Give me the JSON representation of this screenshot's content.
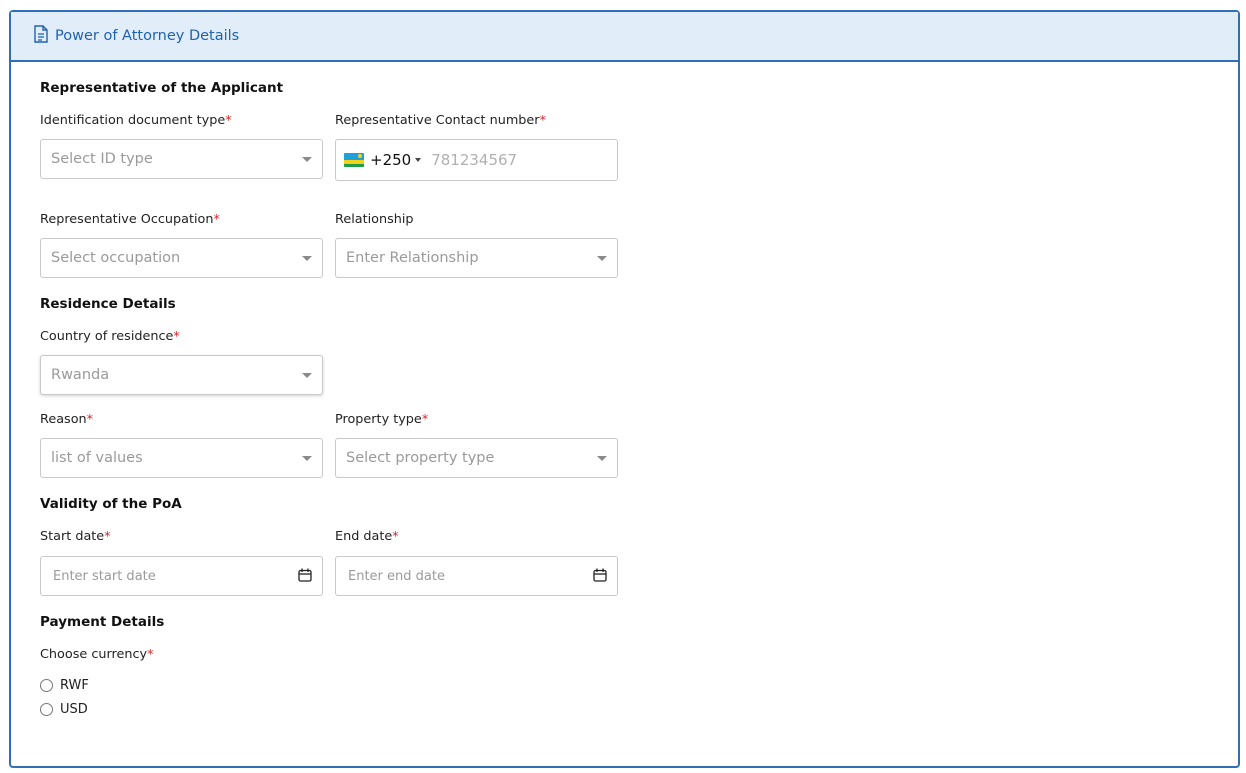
{
  "header": {
    "title": "Power of Attorney Details",
    "icon": "document-icon"
  },
  "sections": {
    "representative": "Representative of the Applicant",
    "residence": "Residence Details",
    "validity": "Validity of the PoA",
    "payment": "Payment Details"
  },
  "fields": {
    "id_type": {
      "label": "Identification document type",
      "placeholder": "Select ID type",
      "required": "*"
    },
    "contact": {
      "label": "Representative Contact number",
      "required": "*",
      "country_code": "+250",
      "placeholder": "781234567",
      "flag": "rwanda-flag"
    },
    "occupation": {
      "label": "Representative Occupation",
      "placeholder": "Select occupation",
      "required": "*"
    },
    "relationship": {
      "label": "Relationship",
      "placeholder": "Enter Relationship"
    },
    "country": {
      "label": "Country of residence",
      "value": "Rwanda",
      "required": "*"
    },
    "reason": {
      "label": "Reason",
      "placeholder": "list of values",
      "required": "*"
    },
    "property_type": {
      "label": "Property type",
      "placeholder": "Select property type",
      "required": "*"
    },
    "start_date": {
      "label": "Start date",
      "placeholder": "Enter start date",
      "required": "*"
    },
    "end_date": {
      "label": "End date",
      "placeholder": "Enter end date",
      "required": "*"
    },
    "currency": {
      "label": "Choose currency",
      "required": "*",
      "options": [
        "RWF",
        "USD"
      ]
    }
  },
  "colors": {
    "accent": "#2f6fb5",
    "header_bg": "#e1edf9",
    "required": "#d9262b"
  }
}
